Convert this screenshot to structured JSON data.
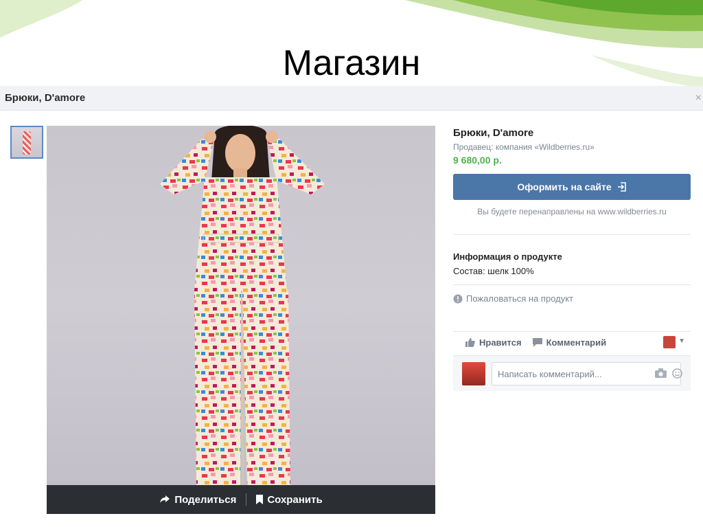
{
  "slide": {
    "title": "Магазин"
  },
  "window": {
    "title": "Брюки, D'amore",
    "close_symbol": "×"
  },
  "product": {
    "name": "Брюки, D'amore",
    "seller": "Продавец: компания «Wildberries.ru»",
    "price": "9 680,00 р.",
    "order_button": "Оформить на сайте",
    "redirect_note": "Вы будете перенаправлены на www.wildberries.ru",
    "info_title": "Информация о продукте",
    "info_text": "Состав: шелк 100%",
    "complaint": "Пожаловаться на продукт"
  },
  "photo_actions": {
    "share": "Поделиться",
    "save": "Сохранить"
  },
  "social": {
    "like": "Нравится",
    "comment": "Комментарий",
    "comment_placeholder": "Написать комментарий..."
  },
  "colors": {
    "accent": "#4a76a8",
    "price": "#4bb34b",
    "action_bar": "#2b2e33",
    "header_bg": "#f0f2f5"
  },
  "icons": {
    "share": "share-arrow-icon",
    "save": "bookmark-icon",
    "order": "external-link-icon",
    "complaint": "exclamation-icon",
    "like": "thumbs-up-icon",
    "comment": "speech-bubble-icon",
    "camera": "camera-icon",
    "emoji": "smiley-icon"
  }
}
